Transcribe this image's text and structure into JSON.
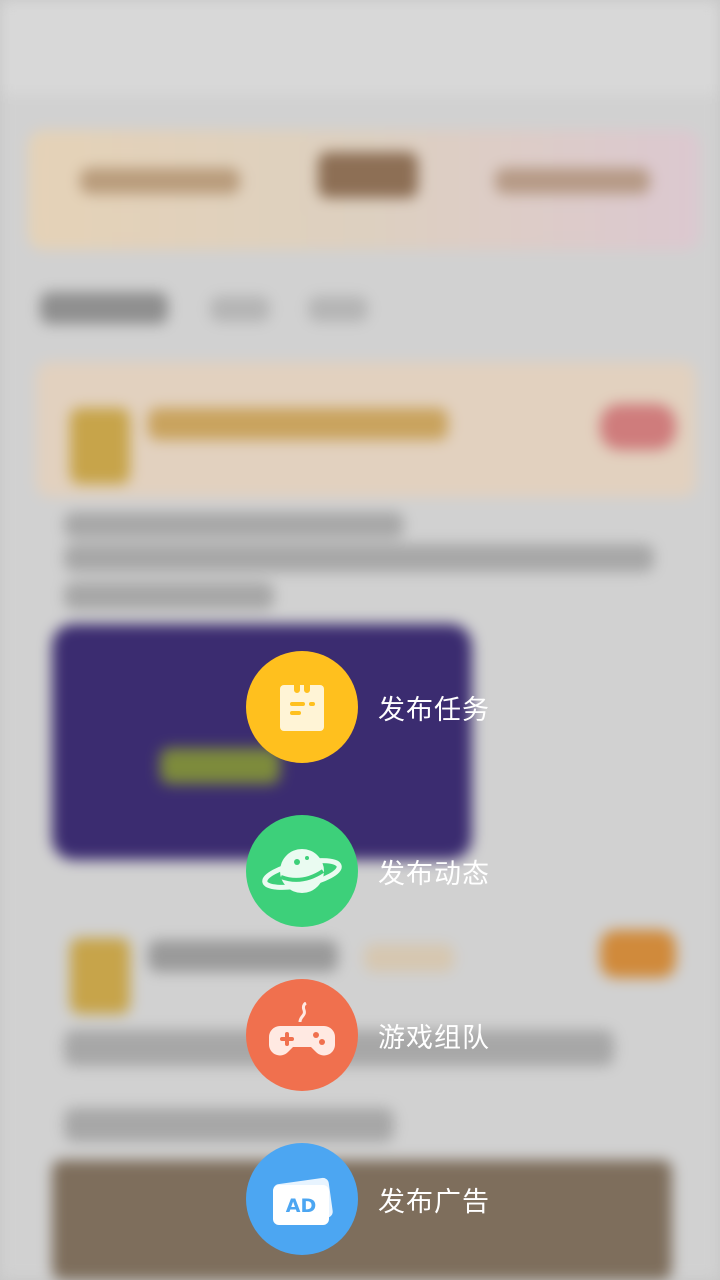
{
  "menu": {
    "items": [
      {
        "label": "发布任务",
        "icon": "task-clipboard-icon",
        "color": "#FFC01E"
      },
      {
        "label": "发布动态",
        "icon": "planet-icon",
        "color": "#3DD07A"
      },
      {
        "label": "游戏组队",
        "icon": "gamepad-icon",
        "color": "#F0704E"
      },
      {
        "label": "发布广告",
        "icon": "ad-card-icon",
        "color": "#4CA6F2",
        "badge_text": "AD"
      }
    ]
  },
  "colors": {
    "overlay": "#c7c7c7",
    "menu_text": "#ffffff"
  }
}
